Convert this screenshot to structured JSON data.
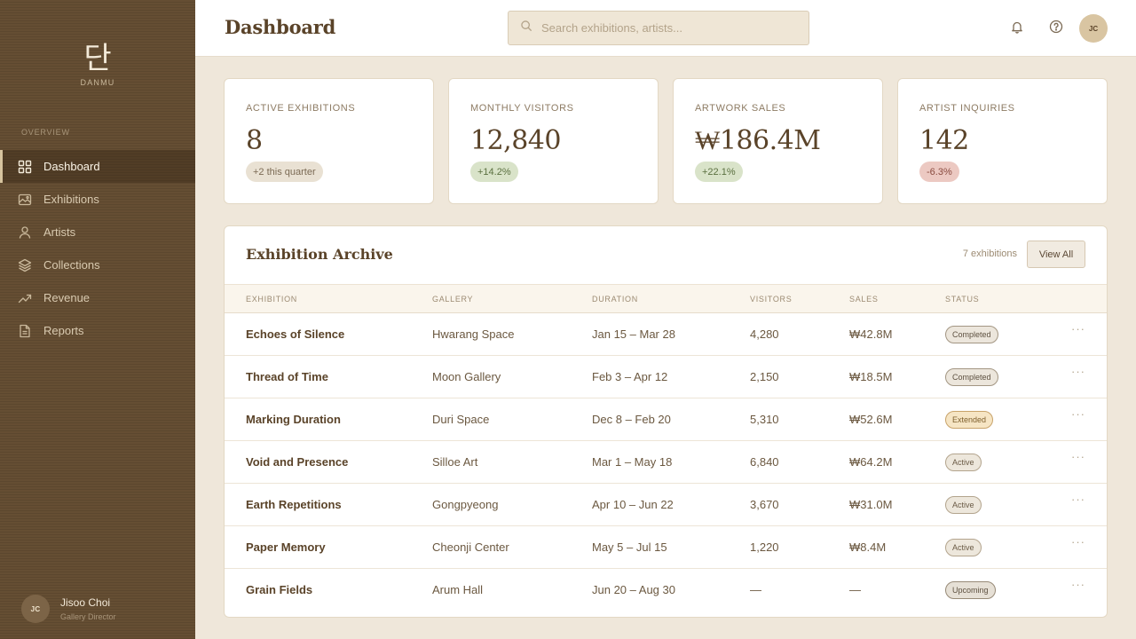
{
  "brand": {
    "mark": "단",
    "name": "DANMU"
  },
  "sidebar": {
    "section_label": "OVERVIEW",
    "items": [
      {
        "label": "Dashboard",
        "icon": "grid-icon",
        "active": true
      },
      {
        "label": "Exhibitions",
        "icon": "image-icon",
        "active": false
      },
      {
        "label": "Artists",
        "icon": "user-icon",
        "active": false
      },
      {
        "label": "Collections",
        "icon": "layers-icon",
        "active": false
      },
      {
        "label": "Revenue",
        "icon": "trending-up-icon",
        "active": false
      },
      {
        "label": "Reports",
        "icon": "file-text-icon",
        "active": false
      }
    ],
    "user": {
      "initials": "JC",
      "name": "Jisoo Choi",
      "role": "Gallery Director"
    }
  },
  "header": {
    "title": "Dashboard",
    "search_placeholder": "Search exhibitions, artists...",
    "avatar_initials": "JC"
  },
  "stats": [
    {
      "label": "ACTIVE EXHIBITIONS",
      "value": "8",
      "badge": "+2 this quarter",
      "trend": "neutral"
    },
    {
      "label": "MONTHLY VISITORS",
      "value": "12,840",
      "badge": "+14.2%",
      "trend": "up"
    },
    {
      "label": "ARTWORK SALES",
      "value": "₩186.4M",
      "badge": "+22.1%",
      "trend": "up"
    },
    {
      "label": "ARTIST INQUIRIES",
      "value": "142",
      "badge": "-6.3%",
      "trend": "down"
    }
  ],
  "archive": {
    "title": "Exhibition Archive",
    "count": "7 exhibitions",
    "view_all": "View All",
    "columns": [
      "EXHIBITION",
      "GALLERY",
      "DURATION",
      "VISITORS",
      "SALES",
      "STATUS"
    ],
    "rows": [
      {
        "exhibition": "Echoes of Silence",
        "gallery": "Hwarang Space",
        "duration": "Jan 15 – Mar 28",
        "visitors": "4,280",
        "sales": "₩42.8M",
        "status": "Completed"
      },
      {
        "exhibition": "Thread of Time",
        "gallery": "Moon Gallery",
        "duration": "Feb 3 – Apr 12",
        "visitors": "2,150",
        "sales": "₩18.5M",
        "status": "Completed"
      },
      {
        "exhibition": "Marking Duration",
        "gallery": "Duri Space",
        "duration": "Dec 8 – Feb 20",
        "visitors": "5,310",
        "sales": "₩52.6M",
        "status": "Extended"
      },
      {
        "exhibition": "Void and Presence",
        "gallery": "Silloe Art",
        "duration": "Mar 1 – May 18",
        "visitors": "6,840",
        "sales": "₩64.2M",
        "status": "Active"
      },
      {
        "exhibition": "Earth Repetitions",
        "gallery": "Gongpyeong",
        "duration": "Apr 10 – Jun 22",
        "visitors": "3,670",
        "sales": "₩31.0M",
        "status": "Active"
      },
      {
        "exhibition": "Paper Memory",
        "gallery": "Cheonji Center",
        "duration": "May 5 – Jul 15",
        "visitors": "1,220",
        "sales": "₩8.4M",
        "status": "Active"
      },
      {
        "exhibition": "Grain Fields",
        "gallery": "Arum Hall",
        "duration": "Jun 20 – Aug 30",
        "visitors": "—",
        "sales": "—",
        "status": "Upcoming"
      }
    ],
    "row_menu": "···"
  },
  "colors": {
    "sidebar": "#654e33",
    "background": "#efe7da",
    "accent_text": "#5a4329",
    "trend_up": "#d9e3c9",
    "trend_down": "#ecc9c2"
  }
}
